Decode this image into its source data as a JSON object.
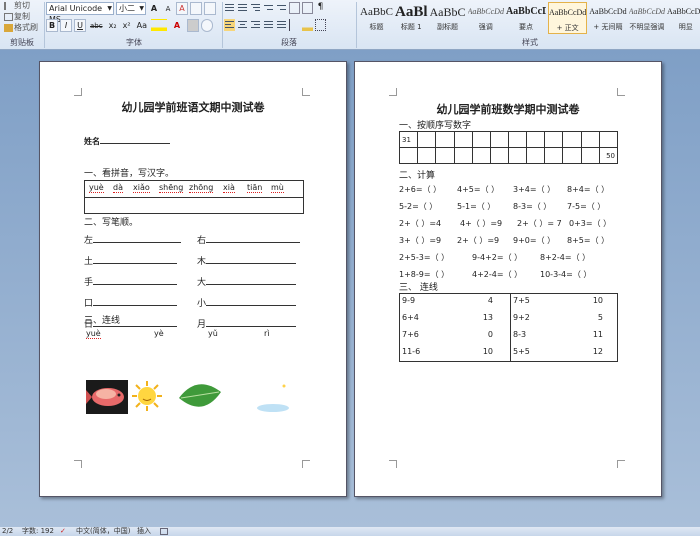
{
  "ribbon": {
    "clipboard": {
      "cut": "剪切",
      "copy": "复制",
      "painter": "格式刷",
      "group_label": "剪贴板"
    },
    "font": {
      "name": "Arial Unicode MS",
      "size": "小二",
      "group_label": "字体",
      "bold": "B",
      "italic": "I",
      "underline": "U",
      "strike": "abc",
      "subscript": "x₂",
      "superscript": "x²",
      "change_case": "Aa",
      "grow": "A",
      "shrink": "A",
      "clear": "A"
    },
    "paragraph": {
      "group_label": "段落"
    },
    "styles": {
      "group_label": "样式",
      "items": [
        {
          "sample": "AaBbC",
          "name": "标题"
        },
        {
          "sample": "AaBl",
          "name": "标题 1"
        },
        {
          "sample": "AaBbC",
          "name": "副标题"
        },
        {
          "sample": "AaBbCcDd",
          "name": "强调"
        },
        {
          "sample": "AaBbCcD",
          "name": "要点"
        },
        {
          "sample": "AaBbCcDd",
          "name": "+ 正文"
        },
        {
          "sample": "AaBbCcDd",
          "name": "+ 无间隔"
        },
        {
          "sample": "AaBbCcDd",
          "name": "不明显强调"
        },
        {
          "sample": "AaBbCcDd",
          "name": "明显"
        }
      ]
    }
  },
  "page1": {
    "title": "幼儿园学前班语文期中测试卷",
    "name_label": "姓名",
    "q1": "一、看拼音，写汉字。",
    "pinyin": [
      "yuè",
      "dà",
      "xiǎo",
      "shēng",
      "zhōng",
      "xià",
      "tiān",
      "mù"
    ],
    "q2": "二、写笔顺。",
    "chars_left": [
      "左",
      "土",
      "手",
      "口",
      "日"
    ],
    "chars_right": [
      "右",
      "木",
      "大",
      "小",
      "月"
    ],
    "q3": "三、连线",
    "connect": [
      "yuè",
      "yè",
      "yǔ",
      "rì"
    ]
  },
  "page2": {
    "title": "幼儿园学前班数学期中测试卷",
    "q1": "一、按顺序写数字",
    "first_num": "31",
    "last_num": "50",
    "q2": "二、计算",
    "calc_rows": [
      [
        "2+6=（ ）",
        "4+5=（ ）",
        "3+4=（ ）",
        "8+4=（ ）"
      ],
      [
        "5-2=（ ）",
        "5-1=（ ）",
        "8-3=（ ）",
        "7-5=（ ）"
      ],
      [
        "2+（ ）=4",
        "4+（ ）=9",
        "2+（ ）= 7",
        "0+3=（ ）"
      ],
      [
        "3+（ ）=9",
        "2+（ ）=9",
        "9+0=（ ）",
        "8+5=（ ）"
      ],
      [
        "2+5-3=（ ）",
        "9-4+2=（ ）",
        "8+2-4=（ ）",
        ""
      ],
      [
        "1+8-9=（ ）",
        "4+2-4=（ ）",
        "10-3-4=（ ）",
        ""
      ]
    ],
    "q3": "三、 连线",
    "line_left": [
      [
        "9-9",
        "4"
      ],
      [
        "6+4",
        "13"
      ],
      [
        "7+6",
        "0"
      ],
      [
        "11-6",
        "10"
      ]
    ],
    "line_right": [
      [
        "7+5",
        "10"
      ],
      [
        "9+2",
        "5"
      ],
      [
        "8-3",
        "11"
      ],
      [
        "5+5",
        "12"
      ]
    ]
  },
  "status": {
    "page": "2/2",
    "words": "字数: 192",
    "lang": "中文(简体，中国)",
    "mode": "插入"
  }
}
